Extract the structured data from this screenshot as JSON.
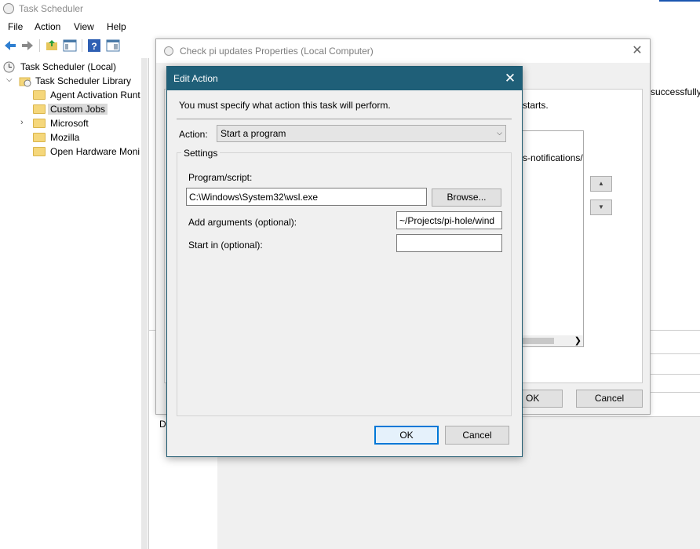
{
  "app": {
    "title": "Task Scheduler",
    "menu": [
      "File",
      "Action",
      "View",
      "Help"
    ]
  },
  "tree": {
    "items": [
      {
        "label": "Task Scheduler (Local)"
      },
      {
        "label": "Task Scheduler Library"
      },
      {
        "label": "Agent Activation Runt"
      },
      {
        "label": "Custom Jobs"
      },
      {
        "label": "Microsoft"
      },
      {
        "label": "Mozilla"
      },
      {
        "label": "Open Hardware Moni"
      }
    ],
    "selected": "Custom Jobs"
  },
  "background": {
    "mid_letter": "D",
    "right_text": "successfully"
  },
  "properties_dialog": {
    "title": "Check pi updates Properties (Local Computer)",
    "starts_text": "starts.",
    "list_item": "s-notifications/",
    "ok_label": "OK",
    "cancel_label": "Cancel"
  },
  "edit_action": {
    "title": "Edit Action",
    "instruction": "You must specify what action this task will perform.",
    "action_label": "Action:",
    "action_value": "Start a program",
    "settings_label": "Settings",
    "program_label": "Program/script:",
    "program_value": "C:\\Windows\\System32\\wsl.exe",
    "browse_label": "Browse...",
    "args_label": "Add arguments (optional):",
    "args_value": "~/Projects/pi-hole/wind",
    "start_label": "Start in (optional):",
    "start_value": "",
    "ok_label": "OK",
    "cancel_label": "Cancel"
  },
  "colors": {
    "dialog_title_bg": "#1f5f78",
    "accent": "#0078d7",
    "folder": "#f5d77b"
  }
}
